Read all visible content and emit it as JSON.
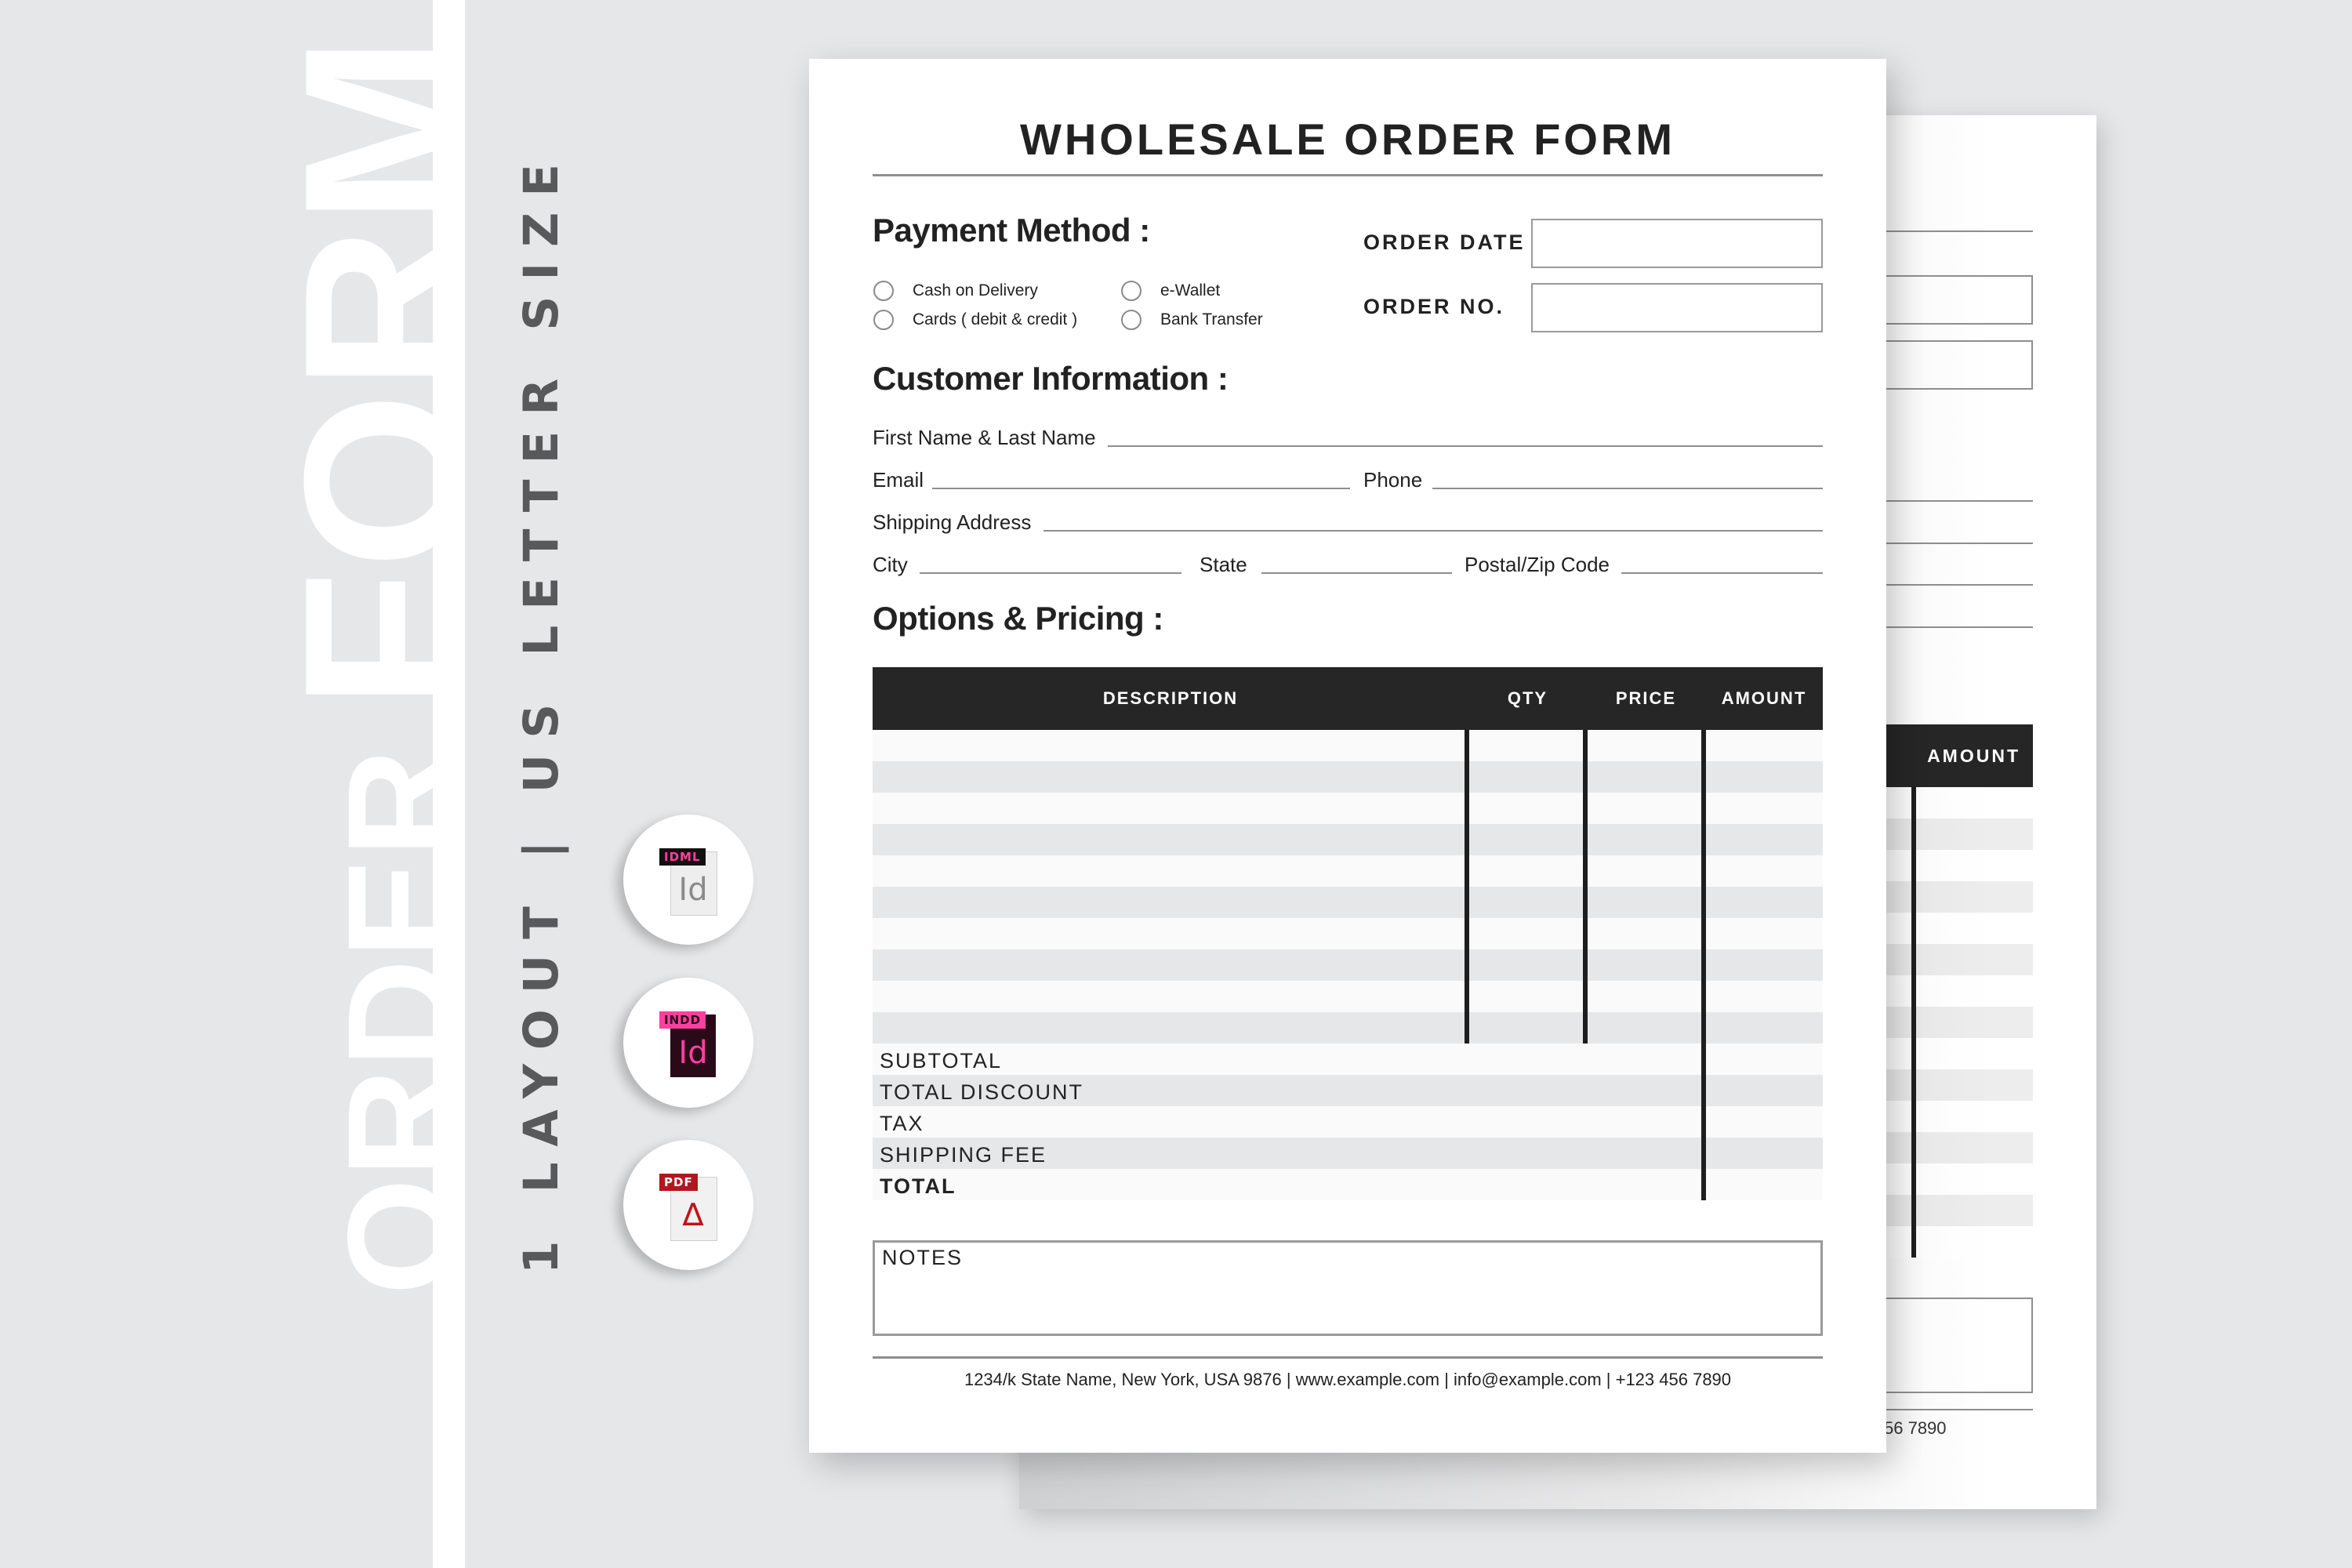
{
  "promo": {
    "big_title_line1": "ORDER",
    "big_title_line2": "FORM",
    "tagline": "1 LAYOUT | US LETTER SIZE",
    "formats": [
      {
        "tag": "IDML",
        "glyph": "Id",
        "icon": "idml-file-icon",
        "tag_bg": "#111111",
        "tag_color": "#ff3fa0",
        "body_bg": "#eeeeee",
        "glyph_color": "#8a8a8a"
      },
      {
        "tag": "INDD",
        "glyph": "Id",
        "icon": "indd-file-icon",
        "tag_bg": "#ff3fa0",
        "tag_color": "#2a0a18",
        "body_bg": "#2a0a18",
        "glyph_color": "#ff3fa0"
      },
      {
        "tag": "PDF",
        "glyph": "∆",
        "icon": "pdf-file-icon",
        "tag_bg": "#b0181f",
        "tag_color": "#ffffff",
        "body_bg": "#f1f1f1",
        "glyph_color": "#c0141c"
      }
    ]
  },
  "form": {
    "title": "WHOLESALE ORDER FORM",
    "payment": {
      "heading": "Payment Method :",
      "options": [
        "Cash on Delivery",
        "Cards ( debit & credit )",
        "e-Wallet",
        "Bank Transfer"
      ]
    },
    "order_meta": {
      "date_label": "ORDER DATE",
      "date_value": "",
      "number_label": "ORDER NO.",
      "number_value": ""
    },
    "customer": {
      "heading": "Customer Information :",
      "fields": {
        "name": "First Name & Last Name",
        "email": "Email",
        "phone": "Phone",
        "address": "Shipping Address",
        "city": "City",
        "state": "State",
        "zip": "Postal/Zip Code"
      }
    },
    "pricing": {
      "heading": "Options & Pricing :",
      "columns": [
        "DESCRIPTION",
        "QTY",
        "PRICE",
        "AMOUNT"
      ],
      "item_rows": 10,
      "totals": [
        "SUBTOTAL",
        "TOTAL DISCOUNT",
        "TAX",
        "SHIPPING FEE",
        "TOTAL"
      ]
    },
    "notes_label": "NOTES",
    "footer": "1234/k State Name, New York, USA 9876 | www.example.com | info@example.com | +123 456 7890"
  },
  "back_page": {
    "amount_label": "AMOUNT",
    "footer_fragment": "56 7890"
  },
  "colors": {
    "background": "#e6e7e9",
    "header_dark": "#262626",
    "row_light": "#fafafa",
    "row_dark": "#e6e7e8",
    "tagline": "#58595b"
  }
}
